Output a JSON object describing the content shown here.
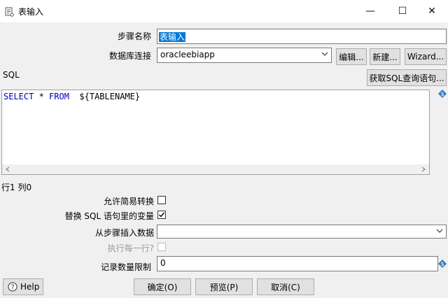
{
  "window": {
    "title": "表输入",
    "minimize_glyph": "—",
    "maximize_glyph": "☐",
    "close_glyph": "✕"
  },
  "form": {
    "step_name_label": "步骤名称",
    "step_name_value": "表输入",
    "db_conn_label": "数据库连接",
    "db_conn_value": "oracleebiapp",
    "edit_btn": "编辑...",
    "new_btn": "新建...",
    "wizard_btn": "Wizard...",
    "sql_label": "SQL",
    "get_sql_btn": "获取SQL查询语句...",
    "sql_kw1": "SELECT",
    "sql_star": " * ",
    "sql_kw2": "FROM",
    "sql_rest": "  ${TABLENAME}",
    "position": "行1 列0",
    "lazy_conv_label": "允许简易转换",
    "lazy_conv_checked": false,
    "replace_vars_label": "替换 SQL 语句里的变量",
    "replace_vars_checked": true,
    "insert_from_label": "从步骤插入数据",
    "insert_from_value": "",
    "exec_each_label": "执行每一行?",
    "exec_each_checked": false,
    "limit_label": "记录数量限制",
    "limit_value": "0"
  },
  "buttons": {
    "help": "Help",
    "ok": "确定(O)",
    "preview": "预览(P)",
    "cancel": "取消(C)"
  },
  "colors": {
    "selection": "#0078d7",
    "keyword": "#0000c0",
    "variable_icon": "#3a7bbf"
  }
}
